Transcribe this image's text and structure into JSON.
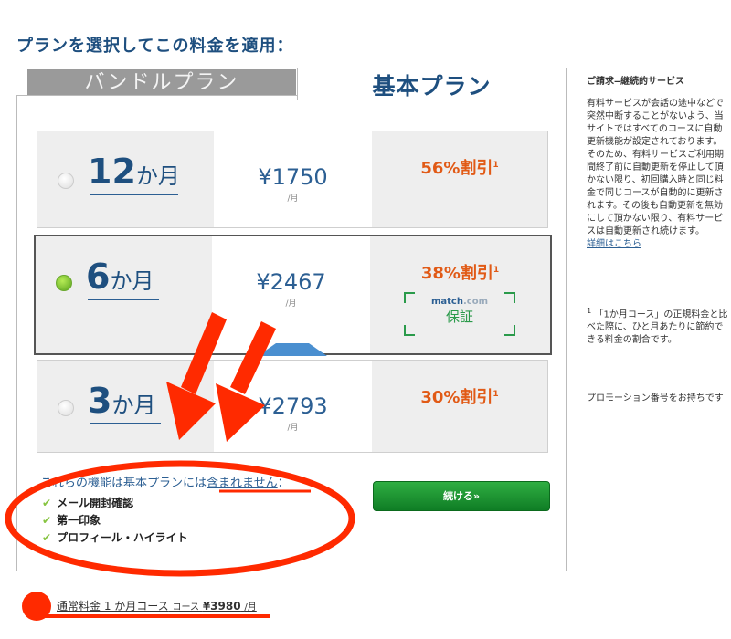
{
  "page_title": "プランを選択してこの料金を適用：",
  "tabs": {
    "bundle": "バンドルプラン",
    "basic": "基本プラン"
  },
  "plans": [
    {
      "num": "12",
      "unit": "か月",
      "price": "¥1750",
      "per": "/月",
      "discount": "56%割引",
      "footnote": "1"
    },
    {
      "num": "6",
      "unit": "か月",
      "price": "¥2467",
      "per": "/月",
      "discount": "38%割引",
      "footnote": "1"
    },
    {
      "num": "3",
      "unit": "か月",
      "price": "¥2793",
      "per": "/月",
      "discount": "30%割引",
      "footnote": "1"
    }
  ],
  "guarantee": {
    "logo_main": "match",
    "logo_suffix": ".com",
    "text": "保証"
  },
  "features": {
    "title_pre": "これらの機能は基本プランには",
    "title_emph": "含まれません",
    "title_post": "：",
    "items": [
      "メール開封確認",
      "第一印象",
      "プロフィール・ハイライト"
    ]
  },
  "continue_label": "続ける»",
  "regular_price": {
    "label": "通常料金 1 か月コース",
    "small": "コース",
    "price": "¥3980",
    "per": "/月"
  },
  "sidebar": {
    "heading": "ご請求‒継続的サービス",
    "body": "有料サービスが会話の途中などで突然中断することがないよう、当サイトではすべてのコースに自動更新機能が設定されております。そのため、有料サービスご利用期間終了前に自動更新を停止して頂かない限り、初回購入時と同じ料金で同じコースが自動的に更新されます。その後も自動更新を無効にして頂かない限り、有料サービスは自動更新され続けます。",
    "link": "詳細はこちら",
    "note_mark": "1",
    "note": "「1か月コース」の正規料金と比べた際に、ひと月あたりに節約できる料金の割合です。",
    "promo": "プロモーション番号をお持ちです"
  },
  "colors": {
    "accent": "#1e4f7f",
    "discount": "#e15a16",
    "button": "#0f7d25",
    "annotation": "#ff2a00"
  }
}
